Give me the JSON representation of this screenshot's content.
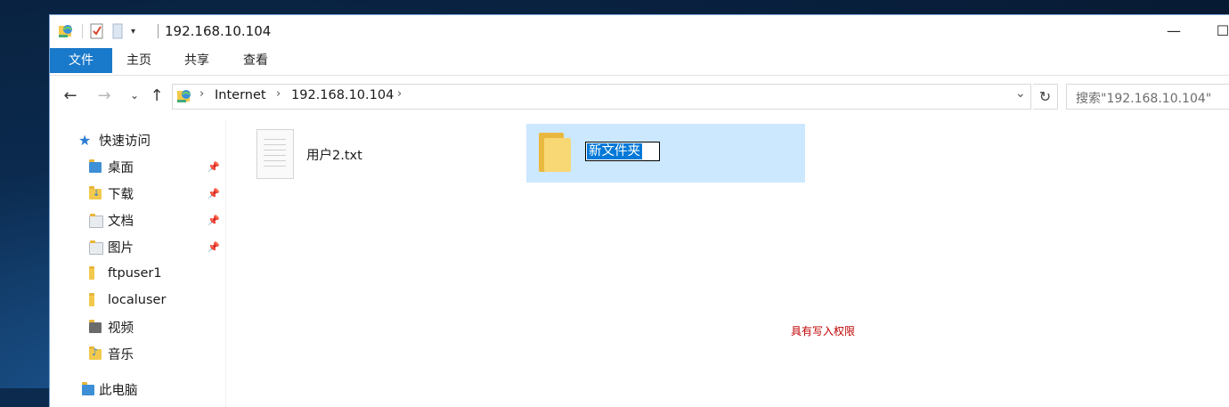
{
  "window": {
    "title": "192.168.10.104",
    "minimize_symbol": "—",
    "maximize_symbol": "☐"
  },
  "ribbon": {
    "tabs": [
      "文件",
      "主页",
      "共享",
      "查看"
    ]
  },
  "address_bar": {
    "segments": [
      "Internet",
      "192.168.10.104"
    ],
    "search_placeholder": "搜索\"192.168.10.104\""
  },
  "nav_pane": {
    "quick_access_label": "快速访问",
    "items": [
      {
        "label": "桌面",
        "pinned": true,
        "icon": "desktop-folder-icon"
      },
      {
        "label": "下载",
        "pinned": true,
        "icon": "downloads-folder-icon"
      },
      {
        "label": "文档",
        "pinned": true,
        "icon": "documents-folder-icon"
      },
      {
        "label": "图片",
        "pinned": true,
        "icon": "pictures-folder-icon"
      },
      {
        "label": "ftpuser1",
        "pinned": false,
        "icon": "folder-icon"
      },
      {
        "label": "localuser",
        "pinned": false,
        "icon": "folder-icon"
      },
      {
        "label": "视频",
        "pinned": false,
        "icon": "videos-folder-icon"
      },
      {
        "label": "音乐",
        "pinned": false,
        "icon": "music-folder-icon"
      }
    ],
    "this_pc_label": "此电脑"
  },
  "content": {
    "files": [
      {
        "name": "用户2.txt",
        "type": "text-file"
      }
    ],
    "renaming_folder": {
      "name": "新文件夹"
    }
  },
  "annotation": {
    "text": "具有写入权限",
    "color": "#c00000"
  },
  "colors": {
    "accent": "#1979ca",
    "selection": "#cce8ff",
    "folder": "#f8d775"
  }
}
